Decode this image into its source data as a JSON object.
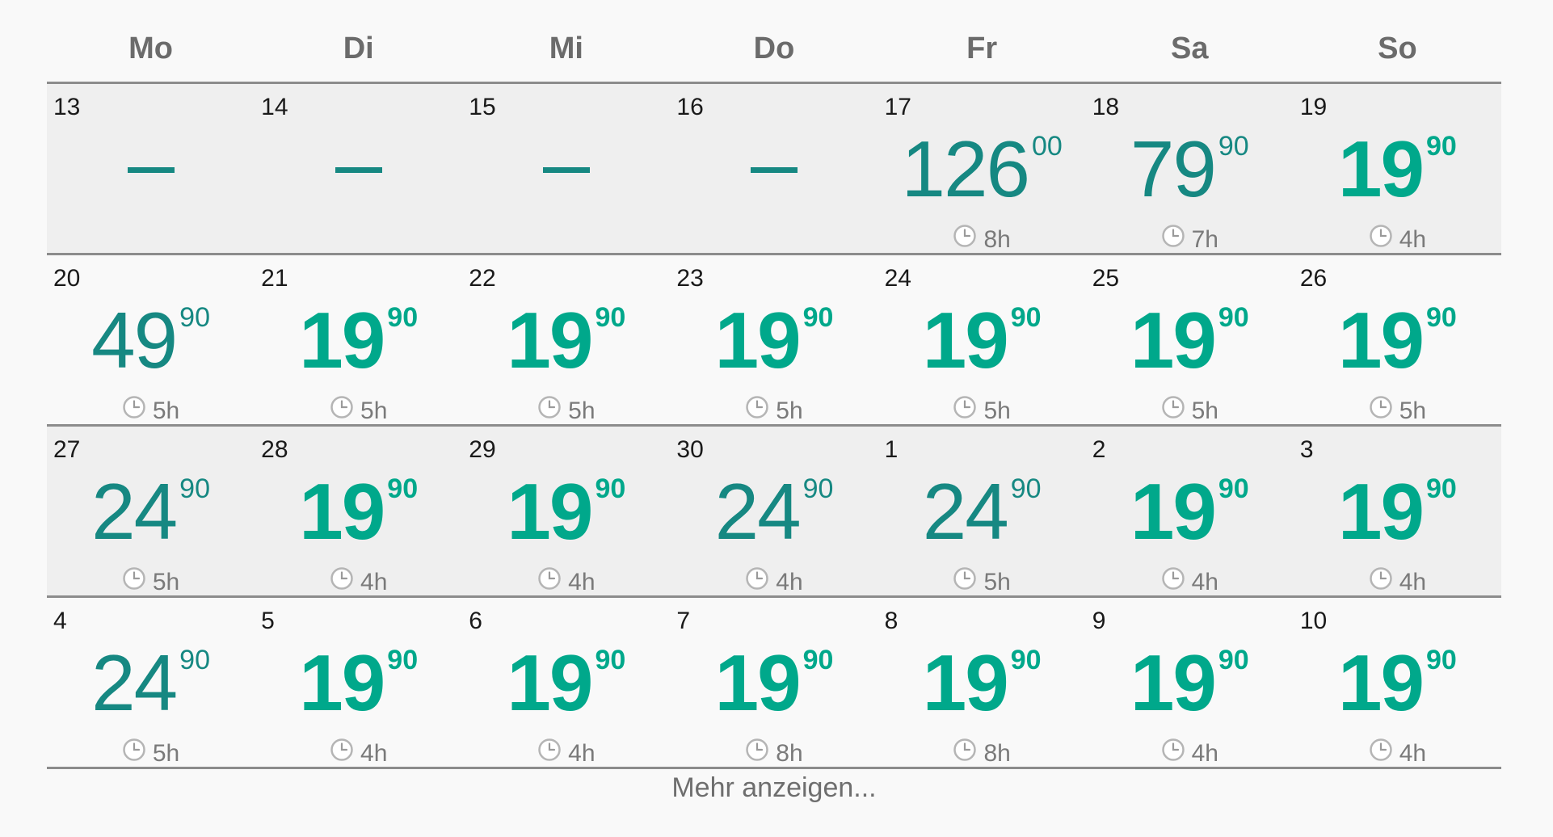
{
  "weekdays": [
    "Mo",
    "Di",
    "Mi",
    "Do",
    "Fr",
    "Sa",
    "So"
  ],
  "colors": {
    "cheap_price": "#00a88b",
    "normal_price": "#168882",
    "text_gray": "#6b6b6b",
    "row_shade": "#efefef"
  },
  "icons": {
    "duration": "clock-icon"
  },
  "weeks": [
    [
      {
        "day": "13",
        "price": null
      },
      {
        "day": "14",
        "price": null
      },
      {
        "day": "15",
        "price": null
      },
      {
        "day": "16",
        "price": null
      },
      {
        "day": "17",
        "price": "126",
        "cents": "00",
        "duration": "8h",
        "cheapest": false
      },
      {
        "day": "18",
        "price": "79",
        "cents": "90",
        "duration": "7h",
        "cheapest": false
      },
      {
        "day": "19",
        "price": "19",
        "cents": "90",
        "duration": "4h",
        "cheapest": true
      }
    ],
    [
      {
        "day": "20",
        "price": "49",
        "cents": "90",
        "duration": "5h",
        "cheapest": false
      },
      {
        "day": "21",
        "price": "19",
        "cents": "90",
        "duration": "5h",
        "cheapest": true
      },
      {
        "day": "22",
        "price": "19",
        "cents": "90",
        "duration": "5h",
        "cheapest": true
      },
      {
        "day": "23",
        "price": "19",
        "cents": "90",
        "duration": "5h",
        "cheapest": true
      },
      {
        "day": "24",
        "price": "19",
        "cents": "90",
        "duration": "5h",
        "cheapest": true
      },
      {
        "day": "25",
        "price": "19",
        "cents": "90",
        "duration": "5h",
        "cheapest": true
      },
      {
        "day": "26",
        "price": "19",
        "cents": "90",
        "duration": "5h",
        "cheapest": true
      }
    ],
    [
      {
        "day": "27",
        "price": "24",
        "cents": "90",
        "duration": "5h",
        "cheapest": false
      },
      {
        "day": "28",
        "price": "19",
        "cents": "90",
        "duration": "4h",
        "cheapest": true
      },
      {
        "day": "29",
        "price": "19",
        "cents": "90",
        "duration": "4h",
        "cheapest": true
      },
      {
        "day": "30",
        "price": "24",
        "cents": "90",
        "duration": "4h",
        "cheapest": false
      },
      {
        "day": "1",
        "price": "24",
        "cents": "90",
        "duration": "5h",
        "cheapest": false
      },
      {
        "day": "2",
        "price": "19",
        "cents": "90",
        "duration": "4h",
        "cheapest": true
      },
      {
        "day": "3",
        "price": "19",
        "cents": "90",
        "duration": "4h",
        "cheapest": true
      }
    ],
    [
      {
        "day": "4",
        "price": "24",
        "cents": "90",
        "duration": "5h",
        "cheapest": false
      },
      {
        "day": "5",
        "price": "19",
        "cents": "90",
        "duration": "4h",
        "cheapest": true
      },
      {
        "day": "6",
        "price": "19",
        "cents": "90",
        "duration": "4h",
        "cheapest": true
      },
      {
        "day": "7",
        "price": "19",
        "cents": "90",
        "duration": "8h",
        "cheapest": true
      },
      {
        "day": "8",
        "price": "19",
        "cents": "90",
        "duration": "8h",
        "cheapest": true
      },
      {
        "day": "9",
        "price": "19",
        "cents": "90",
        "duration": "4h",
        "cheapest": true
      },
      {
        "day": "10",
        "price": "19",
        "cents": "90",
        "duration": "4h",
        "cheapest": true
      }
    ]
  ],
  "more_label": "Mehr anzeigen..."
}
